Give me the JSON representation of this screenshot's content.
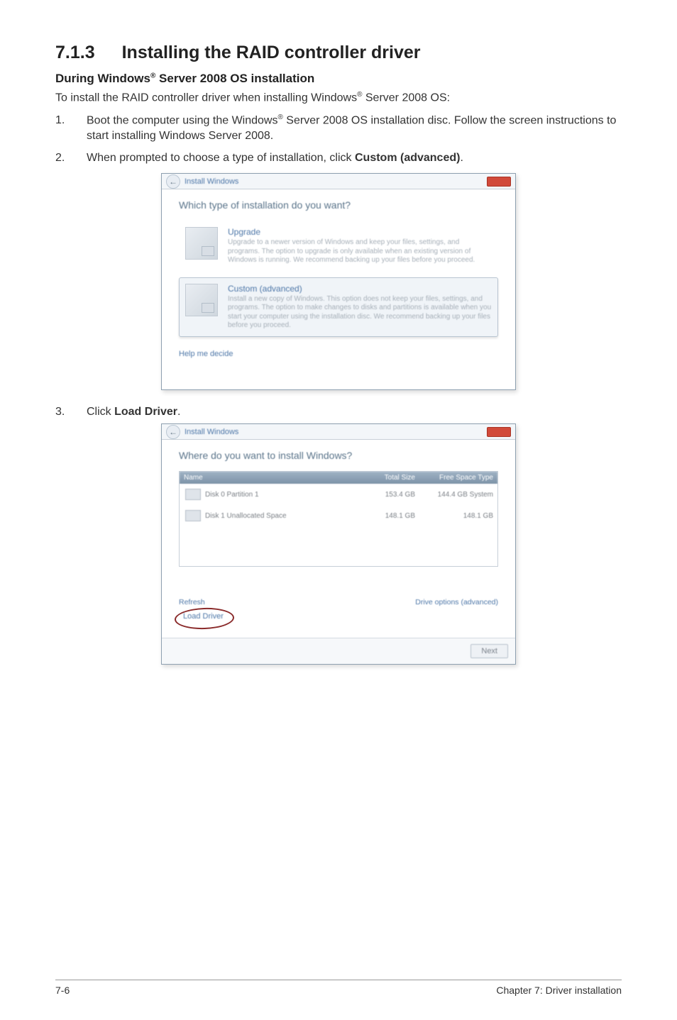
{
  "heading": {
    "num": "7.1.3",
    "title": "Installing the RAID controller driver"
  },
  "sub1": "During Windows",
  "sub1_sup": "®",
  "sub1_rest": " Server 2008 OS installation",
  "intro_a": "To install the RAID controller driver when installing Windows",
  "intro_sup": "®",
  "intro_b": " Server 2008 OS:",
  "step1_a": "Boot the computer using the Windows",
  "step1_sup": "®",
  "step1_b": " Server 2008 OS installation disc. Follow the screen instructions to start installing Windows Server 2008.",
  "step2_a": "When prompted to choose a type of installation, click ",
  "step2_bold": "Custom (advanced)",
  "step2_b": ".",
  "step3_a": "Click ",
  "step3_bold": "Load Driver",
  "step3_b": ".",
  "num1": "1.",
  "num2": "2.",
  "num3": "3.",
  "s1": {
    "title": "Install Windows",
    "question": "Which type of installation do you want?",
    "opt1_title": "Upgrade",
    "opt1_desc": "Upgrade to a newer version of Windows and keep your files, settings, and programs. The option to upgrade is only available when an existing version of Windows is running. We recommend backing up your files before you proceed.",
    "opt2_title": "Custom (advanced)",
    "opt2_desc": "Install a new copy of Windows. This option does not keep your files, settings, and programs. The option to make changes to disks and partitions is available when you start your computer using the installation disc. We recommend backing up your files before you proceed.",
    "help": "Help me decide"
  },
  "s2": {
    "title": "Install Windows",
    "question": "Where do you want to install Windows?",
    "head_name": "Name",
    "head_total": "Total Size",
    "head_free": "Free Space   Type",
    "rows": [
      {
        "name": "Disk 0 Partition 1",
        "total": "153.4 GB",
        "free": "144.4 GB   System"
      },
      {
        "name": "Disk 1 Unallocated Space",
        "total": "148.1 GB",
        "free": "148.1 GB"
      }
    ],
    "refresh": "Refresh",
    "load": "Load Driver",
    "drive": "Drive options (advanced)",
    "next": "Next"
  },
  "footer": {
    "left": "7-6",
    "right": "Chapter 7: Driver installation"
  }
}
